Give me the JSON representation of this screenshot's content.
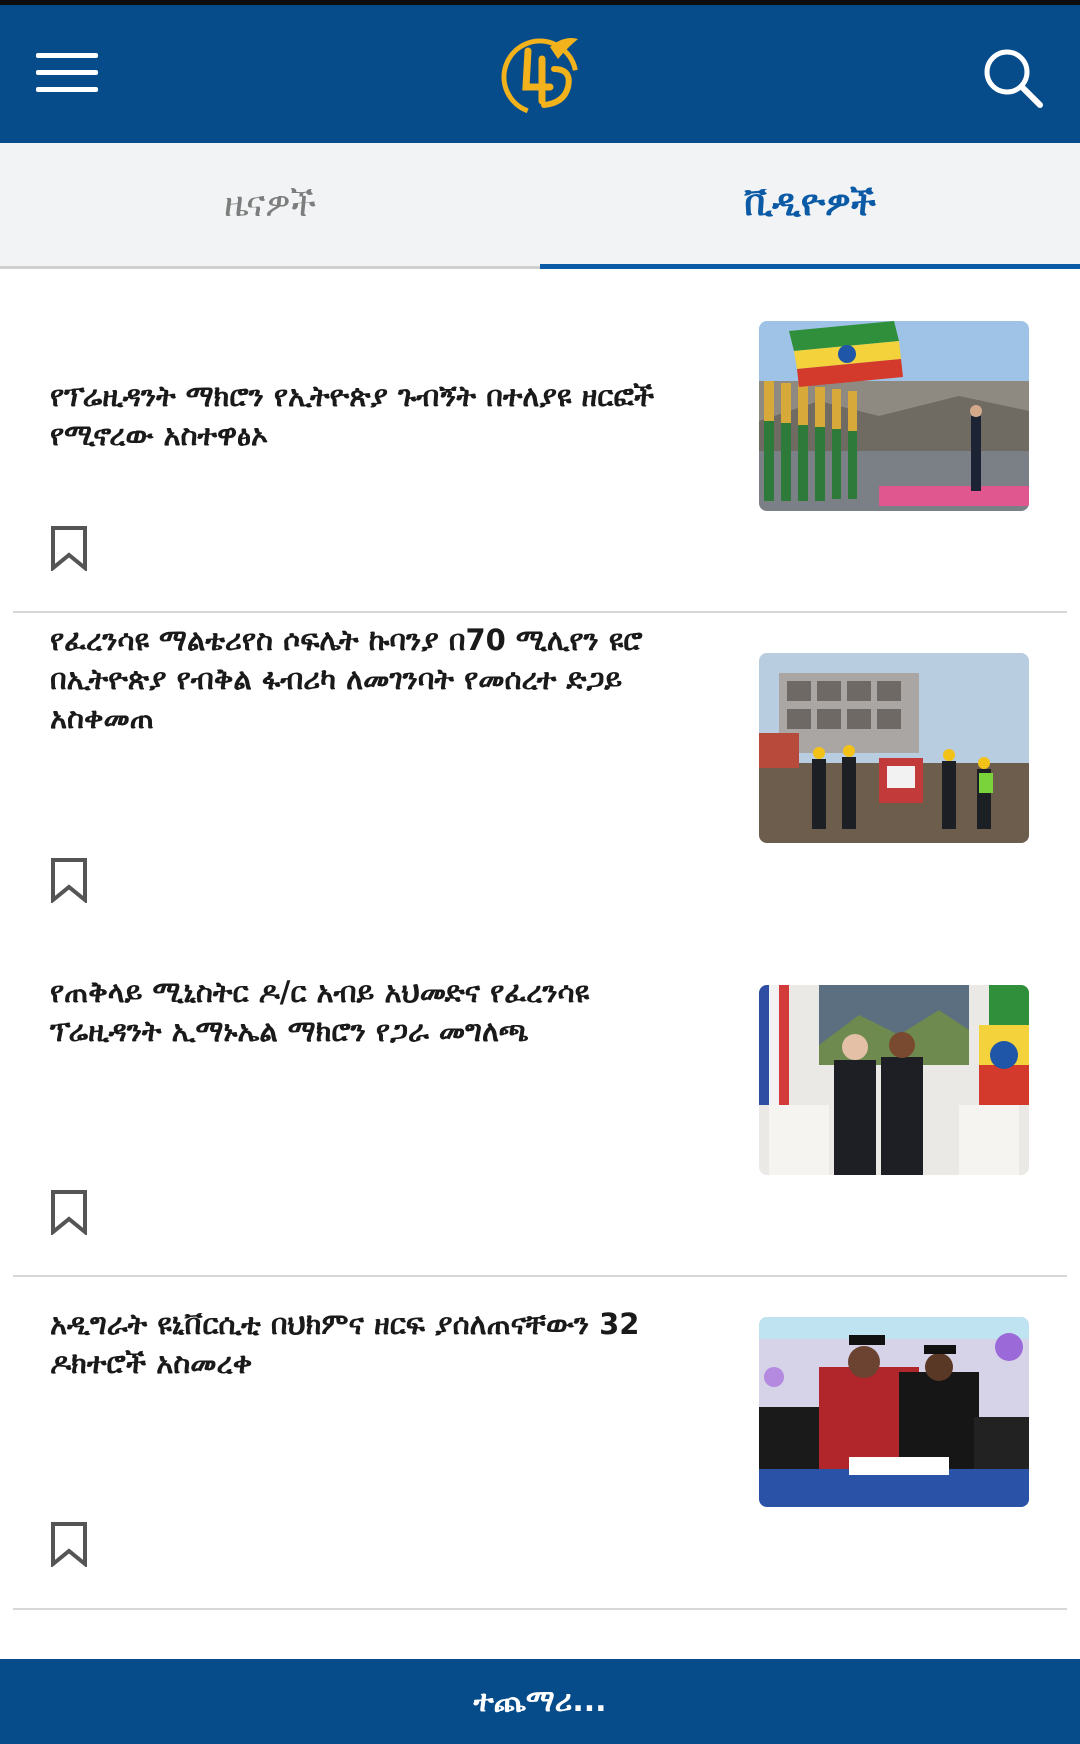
{
  "header": {
    "menu_icon": "hamburger-menu-icon",
    "logo": "channel-logo",
    "search_icon": "search-icon",
    "bg_color": "#064b8a",
    "accent_color": "#f2b21b"
  },
  "tabs": [
    {
      "label": "ዜናዎች",
      "active": false
    },
    {
      "label": "ቪዲዮዎች",
      "active": true
    }
  ],
  "items": [
    {
      "title": "የፕሬዚዳንት ማክሮን የኢትዮጵያ ጉብኝት በተለያዩ ዘርፎች የሚኖረው አስተዋፅኦ",
      "thumb": "flag-ceremony-photo",
      "bookmark_icon": "bookmark-icon"
    },
    {
      "title": "የፈረንሳዩ ማልቴሪየስ ሶፍሌት ኩባንያ በ70 ሚሊየን ዩሮ በኢትዮጵያ የብቅል ፋብሪካ ለመገንባት የመሰረተ ድጋይ አስቀመጠ",
      "thumb": "construction-site-photo",
      "bookmark_icon": "bookmark-icon"
    },
    {
      "title": "የጠቅላይ ሚኒስትር ዶ/ር አብይ አህመድና የፈረንሳዩ ፕሬዚዳንት ኢማኑኤል ማክሮን የጋራ መግለጫ",
      "thumb": "leaders-handshake-photo",
      "bookmark_icon": "bookmark-icon"
    },
    {
      "title": "አዲግራት ዩኒቨርሲቲ በህክምና ዘርፍ ያሰለጠናቸውን 32 ዶክተሮች አስመረቀ",
      "thumb": "graduation-photo",
      "bookmark_icon": "bookmark-icon"
    }
  ],
  "load_more": {
    "label": "ተጨማሪ..."
  }
}
